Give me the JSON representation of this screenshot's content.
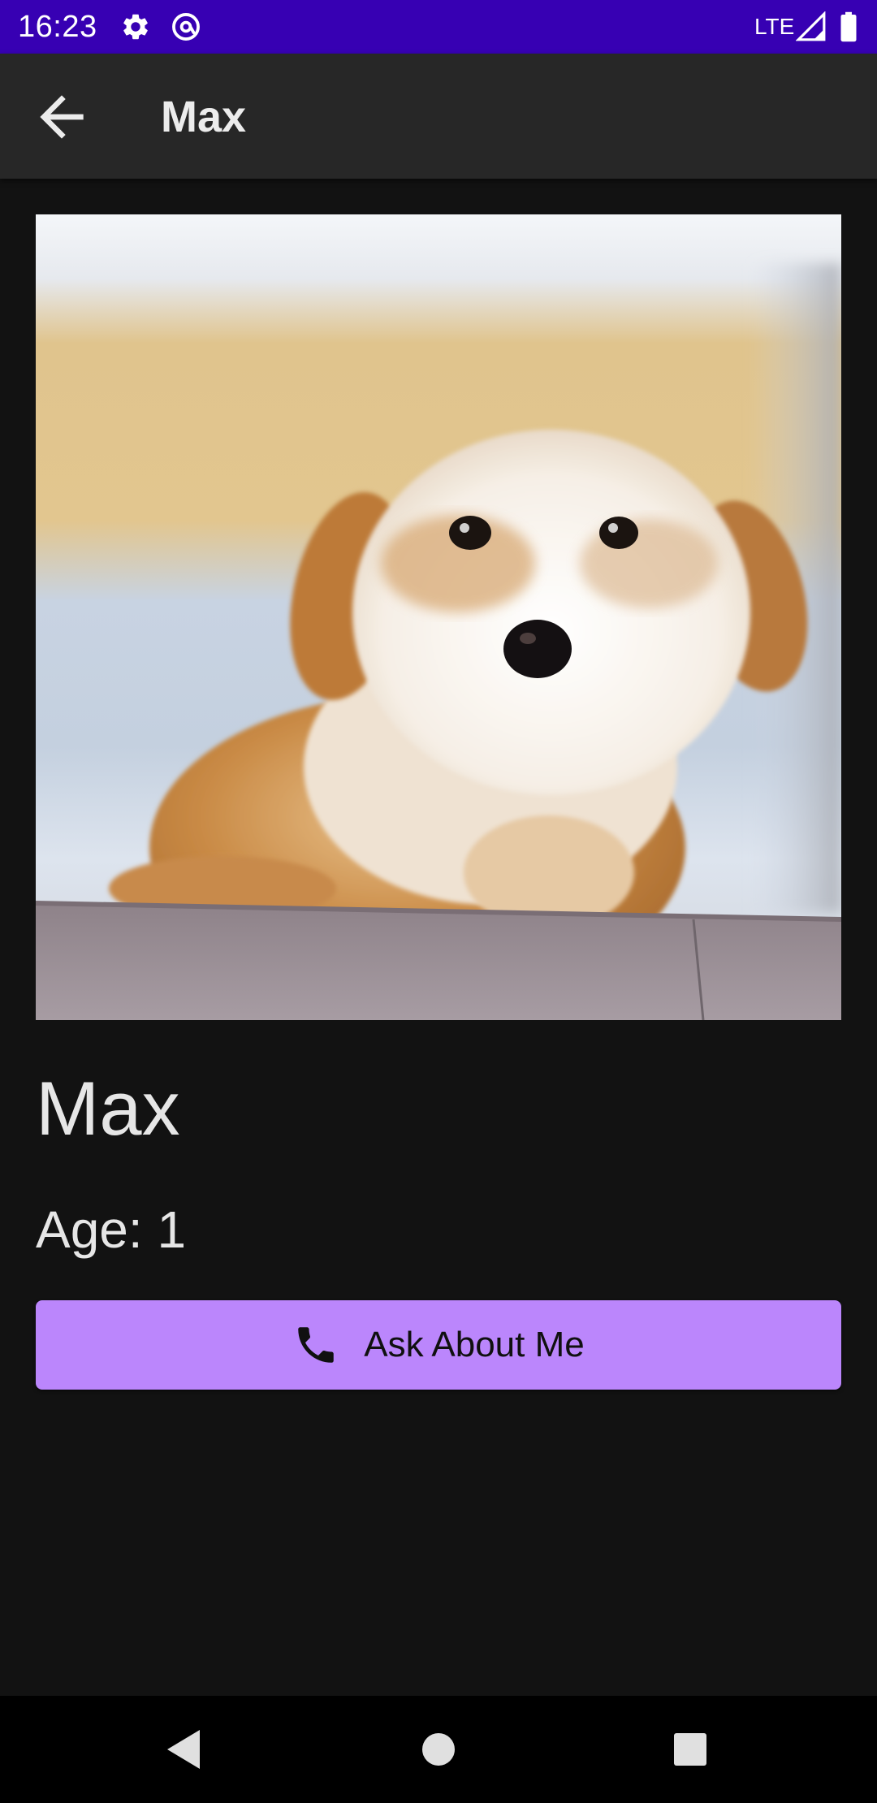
{
  "status_bar": {
    "time": "16:23",
    "network": "LTE",
    "icons": [
      "gear-icon",
      "at-sign-icon",
      "signal-icon",
      "battery-icon"
    ],
    "background": "#3700b3"
  },
  "app_bar": {
    "title": "Max",
    "back_icon": "arrow-left-icon"
  },
  "pet": {
    "photo": "puppy-photo",
    "name": "Max",
    "age_text": "Age: 1"
  },
  "ask_button": {
    "label": "Ask About Me",
    "icon": "phone-icon",
    "color": "#bb86fc"
  },
  "nav_bar": {
    "buttons": [
      "back-triangle-icon",
      "home-circle-icon",
      "recents-square-icon"
    ]
  }
}
